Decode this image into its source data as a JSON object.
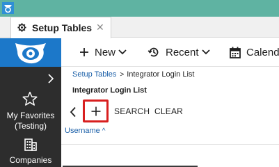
{
  "tab": {
    "label": "Setup Tables",
    "close": "✕"
  },
  "sidebar": {
    "favorites_label": "My Favorites (Testing)",
    "companies_label": "Companies"
  },
  "toolbar": {
    "new_label": "New",
    "recent_label": "Recent",
    "calendar_label": "Calenda"
  },
  "breadcrumb": {
    "parent": "Setup Tables",
    "current": "Integrator Login List"
  },
  "page_title": "Integrator Login List",
  "actions": {
    "search_label": "SEARCH",
    "clear_label": "CLEAR"
  },
  "table": {
    "columns": [
      {
        "label": "Username",
        "sort": "ascending"
      }
    ]
  },
  "colors": {
    "titlebar": "#5fb3a2",
    "brand_blue": "#1c78c9",
    "sidebar": "#2d2d2d",
    "highlight": "#d81f1f",
    "link": "#1a5fa8"
  },
  "icons": [
    "app-logo-icon",
    "gear-icon",
    "close-icon",
    "owl-logo-icon",
    "chevron-right-icon",
    "star-icon",
    "building-icon",
    "plus-icon",
    "chevron-down-icon",
    "history-icon",
    "calendar-icon",
    "chevron-left-icon",
    "sort-up-icon"
  ]
}
